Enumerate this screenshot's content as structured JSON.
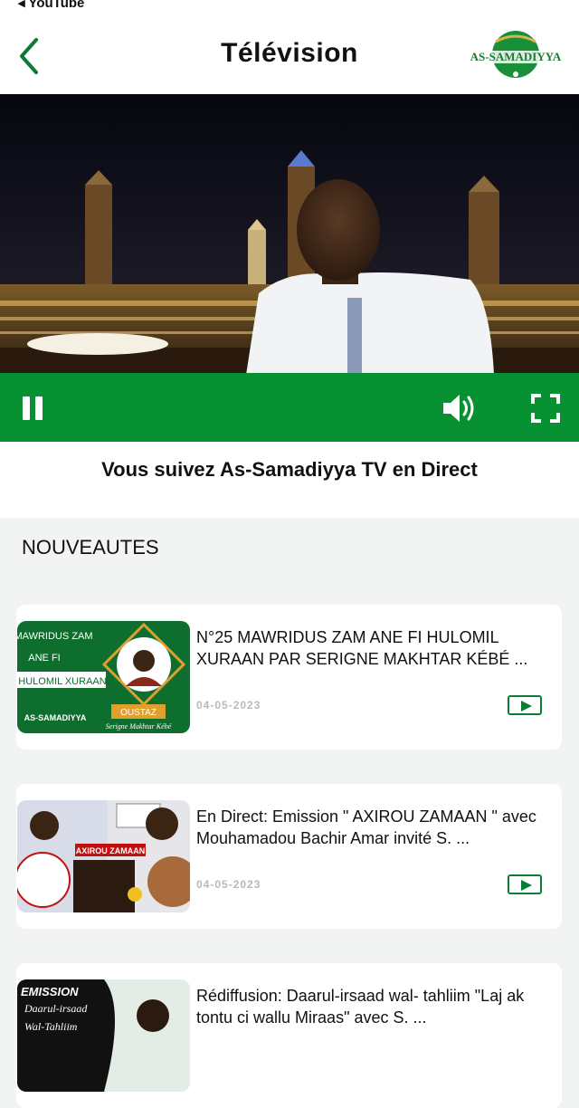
{
  "status_bar": {
    "back_app": "◂ YouTube"
  },
  "header": {
    "title": "Télévision",
    "logo_text": "AS-SAMADIYYA"
  },
  "player": {
    "caption": "Vous suivez As-Samadiyya TV en Direct"
  },
  "section": {
    "title": "NOUVEAUTES"
  },
  "videos": [
    {
      "title": "N°25 MAWRIDUS ZAM ANE FI HULOMIL XURAAN PAR SERIGNE MAKHTAR KÉBÉ ...",
      "date": "04-05-2023",
      "thumb": {
        "line1": "MAWRIDUS ZAM",
        "line2": "ANE FI",
        "line3": "HULOMIL XURAAN",
        "badge": "OUSTAZ",
        "name": "Serigne Makhtar Kébé",
        "brand": "AS-SAMADIYYA"
      }
    },
    {
      "title": "En Direct: Emission \" AXIROU ZAMAAN \" avec Mouhamadou Bachir Amar invité S. ...",
      "date": "04-05-2023",
      "thumb": {
        "banner": "AXIROU ZAMAAN"
      }
    },
    {
      "title": "Rédiffusion: Daarul-irsaad wal- tahliim \"Laj ak tontu ci wallu Miraas\" avec S. ...",
      "date": "",
      "thumb": {
        "line1": "EMISSION",
        "line2": "Daarul-irsaad",
        "line3": "Wal-Tahliim"
      }
    }
  ],
  "colors": {
    "brand_green": "#079133",
    "play_green": "#0a7c34"
  }
}
